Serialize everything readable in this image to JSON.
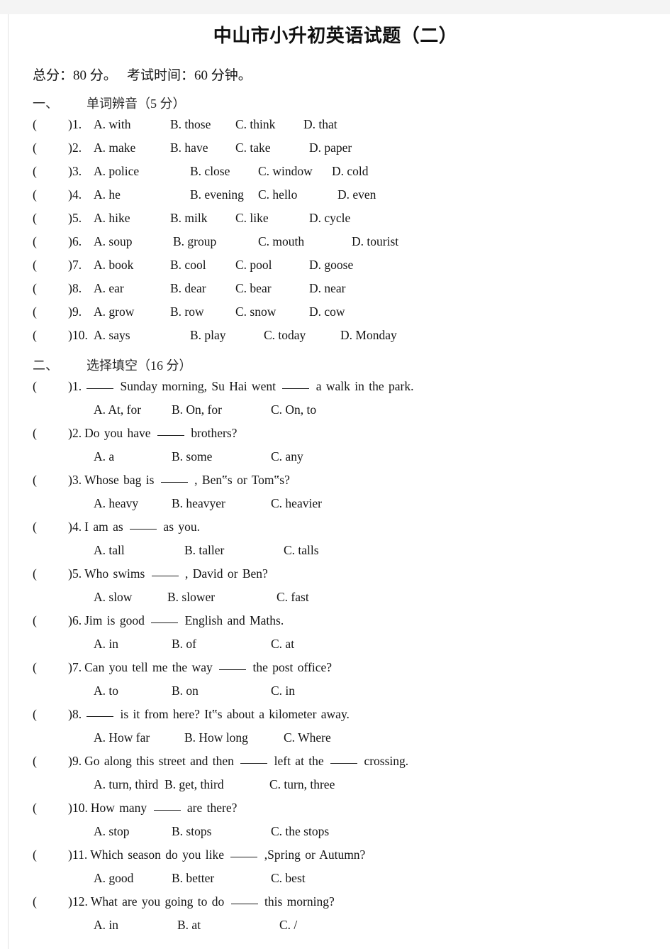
{
  "document": {
    "title": "中山市小升初英语试题（二）",
    "info_line": "总分：80 分。   考试时间：60 分钟。"
  },
  "sections": [
    {
      "number": "一、",
      "title": "单词辨音（5 分）",
      "type": "pronunciation",
      "questions": [
        {
          "num": "1.",
          "a": "A. with",
          "b": "B. those",
          "c": "C. think",
          "d": "D. that",
          "offsets": [
            0,
            108,
            200,
            296
          ]
        },
        {
          "num": "2.",
          "a": "A. make",
          "b": "B. have",
          "c": "C. take",
          "d": "D. paper",
          "offsets": [
            0,
            108,
            200,
            304
          ]
        },
        {
          "num": "3.",
          "a": "A. police",
          "b": "B. close",
          "c": "C. window",
          "d": "D. cold",
          "offsets": [
            0,
            136,
            232,
            336
          ]
        },
        {
          "num": "4.",
          "a": "A. he",
          "b": "B. evening",
          "c": "C. hello",
          "d": "D. even",
          "offsets": [
            0,
            136,
            232,
            344
          ]
        },
        {
          "num": "5.",
          "a": "A. hike",
          "b": "B. milk",
          "c": "C. like",
          "d": "D. cycle",
          "offsets": [
            0,
            108,
            200,
            304
          ]
        },
        {
          "num": "6.",
          "a": "A. soup",
          "b": "B. group",
          "c": "C. mouth",
          "d": "D. tourist",
          "offsets": [
            0,
            112,
            232,
            364
          ]
        },
        {
          "num": "7.",
          "a": "A. book",
          "b": "B. cool",
          "c": "C. pool",
          "d": "D. goose",
          "offsets": [
            0,
            108,
            200,
            304
          ]
        },
        {
          "num": "8.",
          "a": "A. ear",
          "b": "B. dear",
          "c": "C. bear",
          "d": "D. near",
          "offsets": [
            0,
            108,
            200,
            304
          ]
        },
        {
          "num": "9.",
          "a": "A. grow",
          "b": "B. row",
          "c": "C. snow",
          "d": "D. cow",
          "offsets": [
            0,
            108,
            200,
            304
          ]
        },
        {
          "num": "10.",
          "a": "A. says",
          "b": "B. play",
          "c": "C. today",
          "d": "D. Monday",
          "offsets": [
            0,
            136,
            240,
            348
          ]
        }
      ]
    },
    {
      "number": "二、",
      "title": "选择填空（16 分）",
      "type": "fill-in-blank",
      "questions": [
        {
          "num": "1.",
          "stem_parts": [
            "",
            " Sunday morning, Su Hai went ",
            " a walk in the park."
          ],
          "options": [
            "A. At, for",
            "B. On, for",
            "C. On, to"
          ],
          "opt_offsets": [
            0,
            110,
            250
          ]
        },
        {
          "num": "2.",
          "stem_parts": [
            "Do you have ",
            " brothers?"
          ],
          "options": [
            "A. a",
            "B. some",
            "C. any"
          ],
          "opt_offsets": [
            0,
            110,
            250
          ]
        },
        {
          "num": "3.",
          "stem_parts": [
            "Whose bag is ",
            " , Ben‟s or Tom‟s?"
          ],
          "options": [
            "A. heavy",
            "B. heavyer",
            "C. heavier"
          ],
          "opt_offsets": [
            0,
            110,
            250
          ]
        },
        {
          "num": "4.",
          "stem_parts": [
            "I am as ",
            " as you."
          ],
          "options": [
            "A. tall",
            "B. taller",
            "C. talls"
          ],
          "opt_offsets": [
            0,
            128,
            268
          ]
        },
        {
          "num": "5.",
          "stem_parts": [
            "Who swims ",
            " , David or Ben?"
          ],
          "options": [
            "A. slow",
            "B. slower",
            "C. fast"
          ],
          "opt_offsets": [
            0,
            104,
            258
          ]
        },
        {
          "num": "6.",
          "stem_parts": [
            "Jim is good ",
            " English and Maths."
          ],
          "options": [
            "A. in",
            "B. of",
            "C. at"
          ],
          "opt_offsets": [
            0,
            110,
            250
          ]
        },
        {
          "num": "7.",
          "stem_parts": [
            "Can you tell me the way ",
            " the post office?"
          ],
          "options": [
            "A. to",
            "B. on",
            "C. in"
          ],
          "opt_offsets": [
            0,
            110,
            250
          ]
        },
        {
          "num": "8.",
          "stem_parts": [
            "",
            " is it from here?   It‟s about a kilometer away."
          ],
          "options": [
            "A. How far",
            "B. How long",
            "C. Where"
          ],
          "opt_offsets": [
            0,
            128,
            268
          ]
        },
        {
          "num": "9.",
          "stem_parts": [
            "Go along this street and then ",
            " left at the ",
            " crossing."
          ],
          "options": [
            "A. turn, third",
            "B. get, third",
            "C. turn, three"
          ],
          "opt_offsets": [
            0,
            100,
            248
          ]
        },
        {
          "num": "10.",
          "stem_parts": [
            "How many ",
            " are there?"
          ],
          "options": [
            "A. stop",
            "B. stops",
            "C. the stops"
          ],
          "opt_offsets": [
            0,
            110,
            250
          ]
        },
        {
          "num": "11.",
          "stem_parts": [
            "Which season do you like ",
            " ,Spring or Autumn?"
          ],
          "options": [
            "A. good",
            "B. better",
            "C. best"
          ],
          "opt_offsets": [
            0,
            110,
            250
          ]
        },
        {
          "num": "12.",
          "stem_parts": [
            "What are you going to do ",
            " this morning?"
          ],
          "options": [
            "A. in",
            "B. at",
            "C. /"
          ],
          "opt_offsets": [
            0,
            118,
            262
          ]
        }
      ]
    }
  ]
}
